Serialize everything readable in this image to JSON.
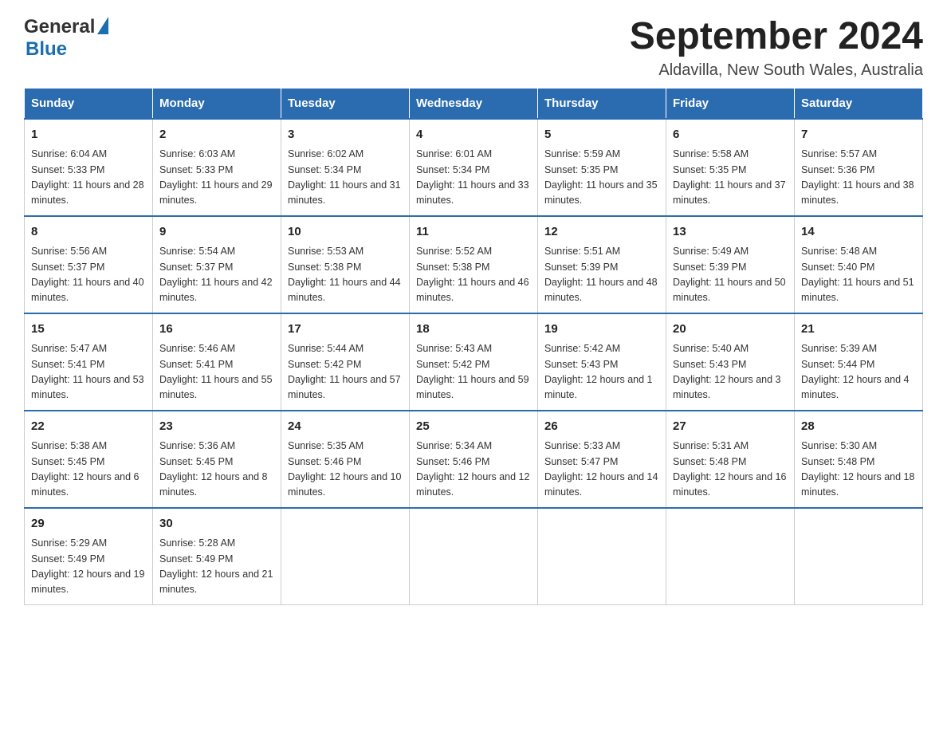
{
  "header": {
    "logo_general": "General",
    "logo_blue": "Blue",
    "month_title": "September 2024",
    "location": "Aldavilla, New South Wales, Australia"
  },
  "days_of_week": [
    "Sunday",
    "Monday",
    "Tuesday",
    "Wednesday",
    "Thursday",
    "Friday",
    "Saturday"
  ],
  "weeks": [
    [
      {
        "day": "1",
        "sunrise": "Sunrise: 6:04 AM",
        "sunset": "Sunset: 5:33 PM",
        "daylight": "Daylight: 11 hours and 28 minutes."
      },
      {
        "day": "2",
        "sunrise": "Sunrise: 6:03 AM",
        "sunset": "Sunset: 5:33 PM",
        "daylight": "Daylight: 11 hours and 29 minutes."
      },
      {
        "day": "3",
        "sunrise": "Sunrise: 6:02 AM",
        "sunset": "Sunset: 5:34 PM",
        "daylight": "Daylight: 11 hours and 31 minutes."
      },
      {
        "day": "4",
        "sunrise": "Sunrise: 6:01 AM",
        "sunset": "Sunset: 5:34 PM",
        "daylight": "Daylight: 11 hours and 33 minutes."
      },
      {
        "day": "5",
        "sunrise": "Sunrise: 5:59 AM",
        "sunset": "Sunset: 5:35 PM",
        "daylight": "Daylight: 11 hours and 35 minutes."
      },
      {
        "day": "6",
        "sunrise": "Sunrise: 5:58 AM",
        "sunset": "Sunset: 5:35 PM",
        "daylight": "Daylight: 11 hours and 37 minutes."
      },
      {
        "day": "7",
        "sunrise": "Sunrise: 5:57 AM",
        "sunset": "Sunset: 5:36 PM",
        "daylight": "Daylight: 11 hours and 38 minutes."
      }
    ],
    [
      {
        "day": "8",
        "sunrise": "Sunrise: 5:56 AM",
        "sunset": "Sunset: 5:37 PM",
        "daylight": "Daylight: 11 hours and 40 minutes."
      },
      {
        "day": "9",
        "sunrise": "Sunrise: 5:54 AM",
        "sunset": "Sunset: 5:37 PM",
        "daylight": "Daylight: 11 hours and 42 minutes."
      },
      {
        "day": "10",
        "sunrise": "Sunrise: 5:53 AM",
        "sunset": "Sunset: 5:38 PM",
        "daylight": "Daylight: 11 hours and 44 minutes."
      },
      {
        "day": "11",
        "sunrise": "Sunrise: 5:52 AM",
        "sunset": "Sunset: 5:38 PM",
        "daylight": "Daylight: 11 hours and 46 minutes."
      },
      {
        "day": "12",
        "sunrise": "Sunrise: 5:51 AM",
        "sunset": "Sunset: 5:39 PM",
        "daylight": "Daylight: 11 hours and 48 minutes."
      },
      {
        "day": "13",
        "sunrise": "Sunrise: 5:49 AM",
        "sunset": "Sunset: 5:39 PM",
        "daylight": "Daylight: 11 hours and 50 minutes."
      },
      {
        "day": "14",
        "sunrise": "Sunrise: 5:48 AM",
        "sunset": "Sunset: 5:40 PM",
        "daylight": "Daylight: 11 hours and 51 minutes."
      }
    ],
    [
      {
        "day": "15",
        "sunrise": "Sunrise: 5:47 AM",
        "sunset": "Sunset: 5:41 PM",
        "daylight": "Daylight: 11 hours and 53 minutes."
      },
      {
        "day": "16",
        "sunrise": "Sunrise: 5:46 AM",
        "sunset": "Sunset: 5:41 PM",
        "daylight": "Daylight: 11 hours and 55 minutes."
      },
      {
        "day": "17",
        "sunrise": "Sunrise: 5:44 AM",
        "sunset": "Sunset: 5:42 PM",
        "daylight": "Daylight: 11 hours and 57 minutes."
      },
      {
        "day": "18",
        "sunrise": "Sunrise: 5:43 AM",
        "sunset": "Sunset: 5:42 PM",
        "daylight": "Daylight: 11 hours and 59 minutes."
      },
      {
        "day": "19",
        "sunrise": "Sunrise: 5:42 AM",
        "sunset": "Sunset: 5:43 PM",
        "daylight": "Daylight: 12 hours and 1 minute."
      },
      {
        "day": "20",
        "sunrise": "Sunrise: 5:40 AM",
        "sunset": "Sunset: 5:43 PM",
        "daylight": "Daylight: 12 hours and 3 minutes."
      },
      {
        "day": "21",
        "sunrise": "Sunrise: 5:39 AM",
        "sunset": "Sunset: 5:44 PM",
        "daylight": "Daylight: 12 hours and 4 minutes."
      }
    ],
    [
      {
        "day": "22",
        "sunrise": "Sunrise: 5:38 AM",
        "sunset": "Sunset: 5:45 PM",
        "daylight": "Daylight: 12 hours and 6 minutes."
      },
      {
        "day": "23",
        "sunrise": "Sunrise: 5:36 AM",
        "sunset": "Sunset: 5:45 PM",
        "daylight": "Daylight: 12 hours and 8 minutes."
      },
      {
        "day": "24",
        "sunrise": "Sunrise: 5:35 AM",
        "sunset": "Sunset: 5:46 PM",
        "daylight": "Daylight: 12 hours and 10 minutes."
      },
      {
        "day": "25",
        "sunrise": "Sunrise: 5:34 AM",
        "sunset": "Sunset: 5:46 PM",
        "daylight": "Daylight: 12 hours and 12 minutes."
      },
      {
        "day": "26",
        "sunrise": "Sunrise: 5:33 AM",
        "sunset": "Sunset: 5:47 PM",
        "daylight": "Daylight: 12 hours and 14 minutes."
      },
      {
        "day": "27",
        "sunrise": "Sunrise: 5:31 AM",
        "sunset": "Sunset: 5:48 PM",
        "daylight": "Daylight: 12 hours and 16 minutes."
      },
      {
        "day": "28",
        "sunrise": "Sunrise: 5:30 AM",
        "sunset": "Sunset: 5:48 PM",
        "daylight": "Daylight: 12 hours and 18 minutes."
      }
    ],
    [
      {
        "day": "29",
        "sunrise": "Sunrise: 5:29 AM",
        "sunset": "Sunset: 5:49 PM",
        "daylight": "Daylight: 12 hours and 19 minutes."
      },
      {
        "day": "30",
        "sunrise": "Sunrise: 5:28 AM",
        "sunset": "Sunset: 5:49 PM",
        "daylight": "Daylight: 12 hours and 21 minutes."
      },
      null,
      null,
      null,
      null,
      null
    ]
  ]
}
